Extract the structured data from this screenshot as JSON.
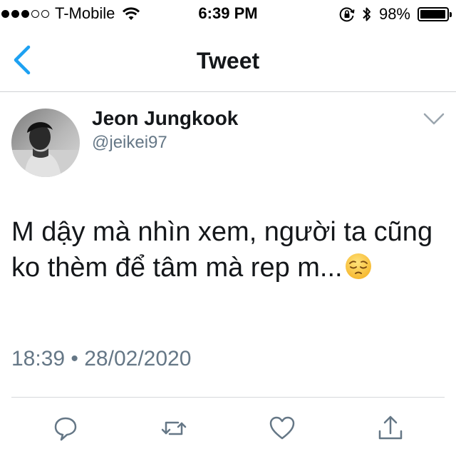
{
  "status_bar": {
    "carrier": "T-Mobile",
    "time": "6:39 PM",
    "battery_percent": "98%",
    "battery_level": 0.98,
    "signal_bars_filled": 3,
    "signal_bars_total": 5
  },
  "nav": {
    "back_icon": "chevron-left-icon",
    "title": "Tweet"
  },
  "tweet": {
    "author_name": "Jeon Jungkook",
    "author_handle": "@jeikei97",
    "text": "M dậy mà nhìn xem, người ta cũng ko thèm để tâm mà rep m...",
    "emoji": "pensive-face-emoji",
    "timestamp": "18:39 • 28/02/2020"
  },
  "actions": [
    {
      "icon": "reply-icon"
    },
    {
      "icon": "retweet-icon"
    },
    {
      "icon": "like-icon"
    },
    {
      "icon": "share-icon"
    }
  ],
  "colors": {
    "accent": "#1da1f2",
    "text_primary": "#14171a",
    "text_secondary": "#657786",
    "icon_gray": "#657786"
  }
}
